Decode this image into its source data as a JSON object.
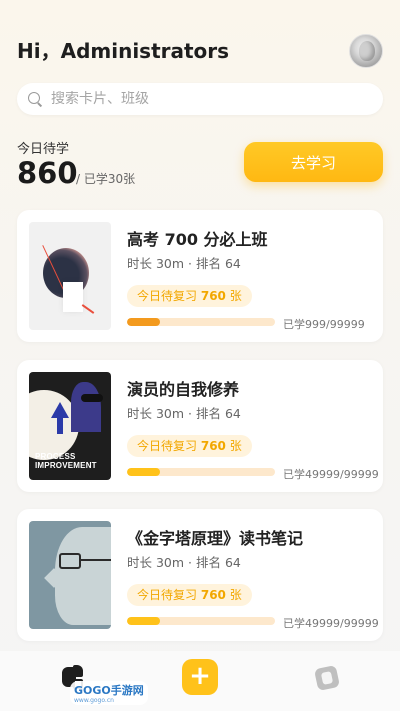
{
  "header": {
    "greeting": "Hi，Administrators"
  },
  "search": {
    "placeholder": "搜索卡片、班级"
  },
  "today": {
    "label": "今日待学",
    "count": "860",
    "sub": "/ 已学30张",
    "button_label": "去学习"
  },
  "cards": [
    {
      "title": "高考 700 分必上班",
      "meta": "时长 30m · 排名 64",
      "review_prefix": "今日待复习",
      "review_count": "760",
      "review_suffix": "张",
      "learned": "已学999/99999",
      "progress": 0.22,
      "progress_color": "#f39a1e",
      "cover_icon": "abstract-circle-cover"
    },
    {
      "title": "演员的自我修养",
      "meta": "时长 30m · 排名 64",
      "review_prefix": "今日待复习",
      "review_count": "760",
      "review_suffix": "张",
      "learned": "已学49999/99999",
      "progress": 0.22,
      "progress_color": "#ffc21a",
      "cover_icon": "process-improvement-cover",
      "cover_text": "PROCESS IMPROVEMENT"
    },
    {
      "title": "《金字塔原理》读书笔记",
      "meta": "时长 30m · 排名 64",
      "review_prefix": "今日待复习",
      "review_count": "760",
      "review_suffix": "张",
      "learned": "已学49999/99999",
      "progress": 0.22,
      "progress_color": "#ffc21a",
      "cover_icon": "profile-head-cover"
    }
  ],
  "tabbar": {
    "home_icon": "home-icon",
    "add_label": "+",
    "cards_icon": "cards-icon",
    "watermark": "GOGO手游网",
    "watermark_url": "www.gogo.cn"
  },
  "colors": {
    "accent": "#ffc21a",
    "accent_dark": "#f39a1e",
    "badge_bg": "#fff3dc"
  }
}
